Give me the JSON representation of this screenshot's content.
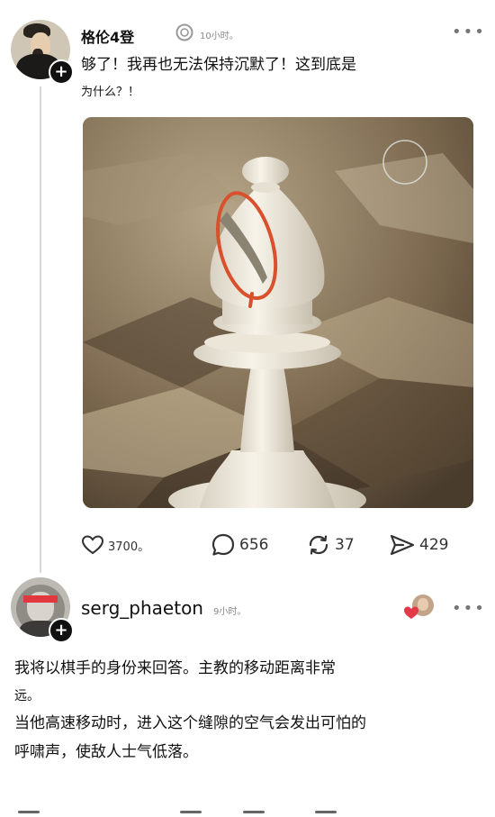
{
  "post": {
    "author": "格伦4登",
    "time": "10小时。",
    "text_line1": "够了！我再也无法保持沉默了！这到底是",
    "text_line2": "为什么？！",
    "stats": {
      "likes": "3700。",
      "comments": "656",
      "reposts": "37",
      "shares": "429"
    }
  },
  "reply": {
    "author": "serg_phaeton",
    "time": "9小时。",
    "lines": [
      "我将以棋手的身份来回答。主教的移动距离非常",
      "远。",
      "当他高速移动时，进入这个缝隙的空气会发出可怕的",
      "呼啸声，使敌人士气低落。"
    ]
  },
  "icons": {
    "more": "more-horizontal-icon",
    "follow": "plus-icon",
    "like": "heart-icon",
    "comment": "speech-bubble-icon",
    "repost": "repost-icon",
    "share": "send-icon",
    "circle": "loading-circle-icon"
  },
  "colors": {
    "accent_heart": "#e23a47",
    "annotation": "#d9502c",
    "text": "#111111",
    "muted": "#888888"
  }
}
